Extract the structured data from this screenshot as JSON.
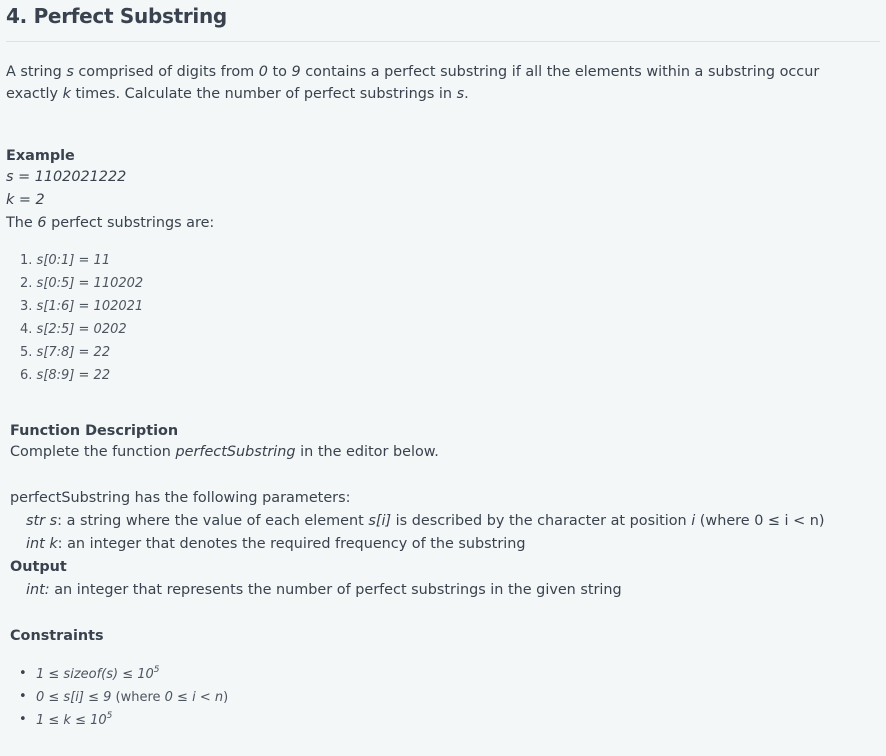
{
  "title": "4. Perfect Substring",
  "intro": {
    "a": "A string ",
    "b": "s",
    "c": " comprised of digits from ",
    "d": "0",
    "e": " to ",
    "f": "9",
    "g": " contains a perfect substring if all the elements within a substring occur",
    "h": "exactly ",
    "i": "k",
    "j": " times. Calculate the number of perfect substrings in ",
    "k": "s",
    "l": "."
  },
  "example": {
    "heading": "Example",
    "s_line": "s = 1102021222",
    "k_line": "k = 2",
    "count_a": "The ",
    "count_b": "6",
    "count_c": " perfect substrings are:",
    "items": [
      {
        "num": "1.",
        "text": "s[0:1] = 11"
      },
      {
        "num": "2.",
        "text": "s[0:5] = 110202"
      },
      {
        "num": "3.",
        "text": "s[1:6] = 102021"
      },
      {
        "num": "4.",
        "text": "s[2:5] = 0202"
      },
      {
        "num": "5.",
        "text": "s[7:8] = 22"
      },
      {
        "num": "6.",
        "text": "s[8:9] = 22"
      }
    ]
  },
  "function_description": {
    "heading": "Function Description",
    "line_a": "Complete the function ",
    "line_b": "perfectSubstring",
    "line_c": " in the editor below.",
    "params_intro": "perfectSubstring has the following parameters:",
    "p1_a": "str s",
    "p1_b": ": a string where the value of each element ",
    "p1_c": "s[i]",
    "p1_d": " is described by the character at position ",
    "p1_e": "i",
    "p1_f": " (where 0 ≤ i < n)",
    "p2_a": "int k",
    "p2_b": ": an integer that denotes the required frequency of the substring"
  },
  "output": {
    "heading": "Output",
    "a": "int:",
    "b": " an integer that represents the number of perfect substrings in the given string"
  },
  "constraints": {
    "heading": "Constraints",
    "c1_a": "1 ≤ sizeof(s) ≤ 10",
    "c1_sup": "5",
    "c2_a": "0 ≤ s[i] ≤ 9",
    "c2_b": " (where ",
    "c2_c": "0 ≤ i < n",
    "c2_d": ")",
    "c3_a": "1 ≤ k ≤ 10",
    "c3_sup": "5",
    "bullet": "•"
  }
}
